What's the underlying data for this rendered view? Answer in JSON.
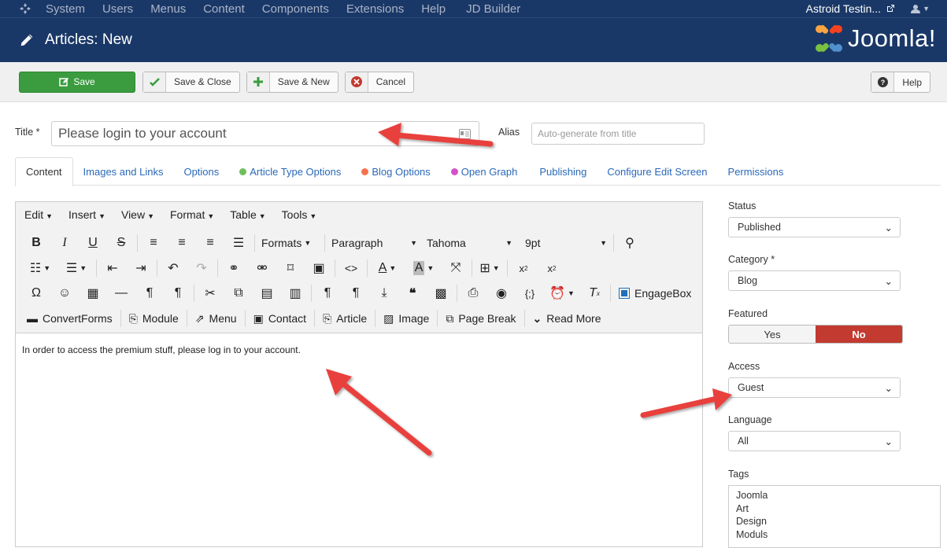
{
  "topnav": {
    "menus": [
      "System",
      "Users",
      "Menus",
      "Content",
      "Components",
      "Extensions",
      "Help",
      "JD Builder"
    ],
    "site_name": "Astroid Testin..."
  },
  "header": {
    "title": "Articles: New",
    "brand": "Joomla!"
  },
  "toolbar": {
    "save": "Save",
    "save_close": "Save & Close",
    "save_new": "Save & New",
    "cancel": "Cancel",
    "help": "Help"
  },
  "form": {
    "title_label": "Title *",
    "title_value": "Please login to your account",
    "alias_label": "Alias",
    "alias_placeholder": "Auto-generate from title"
  },
  "tabs": [
    {
      "label": "Content"
    },
    {
      "label": "Images and Links"
    },
    {
      "label": "Options"
    },
    {
      "label": "Article Type Options",
      "dot": "#6fbf5e"
    },
    {
      "label": "Blog Options",
      "dot": "#f5734f"
    },
    {
      "label": "Open Graph",
      "dot": "#d451c9"
    },
    {
      "label": "Publishing"
    },
    {
      "label": "Configure Edit Screen"
    },
    {
      "label": "Permissions"
    }
  ],
  "editor": {
    "menubar": [
      "Edit",
      "Insert",
      "View",
      "Format",
      "Table",
      "Tools"
    ],
    "formats": "Formats",
    "block": "Paragraph",
    "font": "Tahoma",
    "size": "9pt",
    "engagebox": "EngageBox",
    "buttons": [
      "ConvertForms",
      "Module",
      "Menu",
      "Contact",
      "Article",
      "Image",
      "Page Break",
      "Read More"
    ],
    "content": "In order to access the premium stuff, please log in to your account."
  },
  "sidebar": {
    "status_label": "Status",
    "status_value": "Published",
    "category_label": "Category *",
    "category_value": "Blog",
    "featured_label": "Featured",
    "featured_yes": "Yes",
    "featured_no": "No",
    "access_label": "Access",
    "access_value": "Guest",
    "language_label": "Language",
    "language_value": "All",
    "tags_label": "Tags",
    "tags": [
      "Joomla",
      "Art",
      "Design",
      "Moduls"
    ]
  },
  "colors": {
    "navbar": "#1a3867",
    "save": "#3a9c3f",
    "featured_no": "#c23a30",
    "arrow": "#e8413c",
    "link": "#2a69b8"
  }
}
